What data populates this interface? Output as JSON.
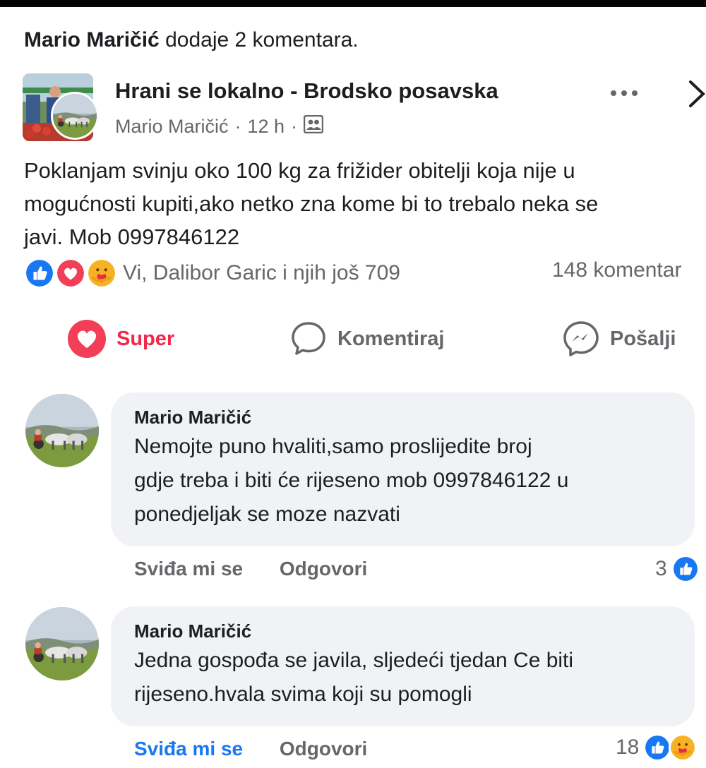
{
  "activity": {
    "actor": "Mario Maričić",
    "text": "dodaje 2 komentara."
  },
  "post": {
    "group_name": "Hrani se lokalno - Brodsko posavska",
    "author": "Mario Maričić",
    "time": "12 h",
    "separator": "·",
    "privacy_icon": "members-icon",
    "text": "Poklanjam svinju oko 100 kg za frižider obitelji koja nije u\nmogućnosti kupiti,ako netko zna kome bi to trebalo neka se\njavi. Mob 0997846122",
    "reactions_text": "Vi, Dalibor Garic i njih još 709",
    "comments_count": "148 komentar",
    "reaction_icons": [
      "like-icon",
      "love-icon",
      "care-icon"
    ]
  },
  "actions": {
    "super_label": "Super",
    "comment_label": "Komentiraj",
    "send_label": "Pošalji"
  },
  "comments": [
    {
      "author": "Mario Maričić",
      "text": "Nemojte puno hvaliti,samo proslijedite broj\ngdje treba i biti će rijeseno mob 0997846122 u\nponedjeljak se moze nazvati",
      "like_label": "Sviđa mi se",
      "reply_label": "Odgovori",
      "reaction_count": "3",
      "liked": false
    },
    {
      "author": "Mario Maričić",
      "text": "Jedna gospođa se javila, sljedeći tjedan Ce biti\nrijeseno.hvala svima koji su pomogli",
      "like_label": "Sviđa mi se",
      "reply_label": "Odgovori",
      "reaction_count": "18",
      "liked": true
    }
  ],
  "colors": {
    "text": "#1c1e21",
    "secondary": "#65676b",
    "love": "#f02849",
    "like": "#1877f2",
    "bubble": "#f0f2f5"
  }
}
